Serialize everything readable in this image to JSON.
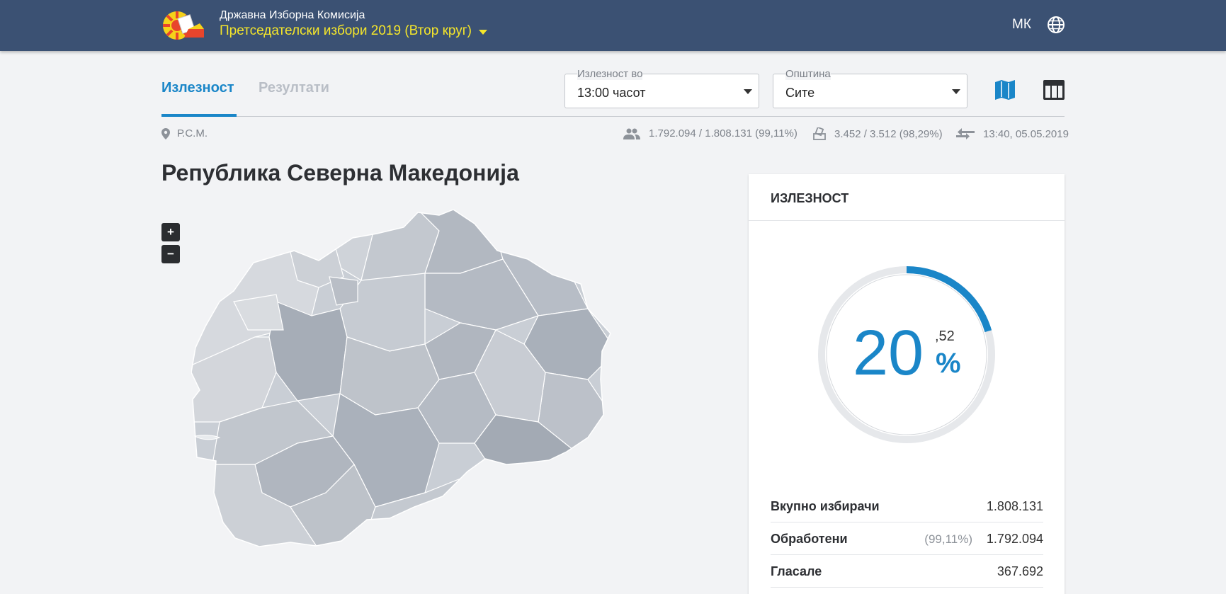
{
  "header": {
    "org_name": "Државна Изборна Комисија",
    "election": "Претседателски избори 2019 (Втор круг)",
    "language": "МК",
    "logo_icon": "dik-logo",
    "globe_icon": "globe-icon"
  },
  "tabs": [
    {
      "label": "Излезност",
      "active": true
    },
    {
      "label": "Резултати",
      "active": false
    }
  ],
  "filters": {
    "time": {
      "label": "Излезност во",
      "value": "13:00 часот"
    },
    "municipality": {
      "label": "Општина",
      "value": "Сите"
    }
  },
  "views": {
    "map_icon": "map-icon",
    "table_icon": "table-icon"
  },
  "breadcrumb": "Р.С.М.",
  "stats": {
    "voters": "1.792.094 / 1.808.131 (99,11%)",
    "stations": "3.452 / 3.512 (98,29%)",
    "updated": "13:40, 05.05.2019"
  },
  "region_title": "Република Северна Македонија",
  "map": {
    "zoom_in": "+",
    "zoom_out": "−"
  },
  "turnout_card": {
    "title": "ИЗЛЕЗНОСТ",
    "percent_int": "20",
    "percent_dec": ",52",
    "percent_sign": "%",
    "percent_value": 20.52,
    "rows": [
      {
        "label": "Вкупно избирачи",
        "value": "1.808.131",
        "pct": ""
      },
      {
        "label": "Обработени",
        "value": "1.792.094",
        "pct": "(99,11%)"
      },
      {
        "label": "Гласале",
        "value": "367.692",
        "pct": ""
      }
    ]
  },
  "colors": {
    "header_bg": "#3b5173",
    "accent": "#1a86c8",
    "election_text": "#f5e62a",
    "map_fill": "#c5cad1"
  }
}
